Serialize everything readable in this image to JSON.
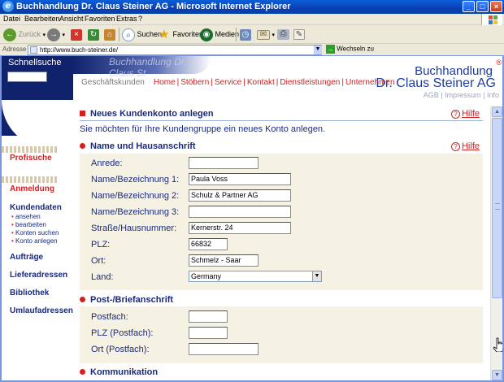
{
  "window": {
    "title": "Buchhandlung Dr. Claus Steiner AG - Microsoft Internet Explorer"
  },
  "menu": [
    "Datei",
    "Bearbeiten",
    "Ansicht",
    "Favoriten",
    "Extras",
    "?"
  ],
  "toolbar": {
    "back": "Zurück",
    "search": "Suchen",
    "favorites": "Favoriten",
    "media": "Medien"
  },
  "address": {
    "label": "Adresse",
    "url": "http://www.buch-steiner.de/",
    "go": "Wechseln zu"
  },
  "leftnav": {
    "quicksearch": "Schnellsuche",
    "profisuche": "Profisuche",
    "anmeldung": "Anmeldung",
    "kundendaten": "Kundendaten",
    "kundendaten_items": [
      "ansehen",
      "bearbeiten",
      "Konten suchen",
      "Konto anlegen"
    ],
    "auftraege": "Aufträge",
    "lieferadressen": "Lieferadressen",
    "bibliothek": "Bibliothek",
    "umlaufadressen": "Umlaufadressen"
  },
  "header": {
    "brand_line1": "Buchhandlung",
    "brand_line2": "Dr. Claus Steiner AG",
    "brand_reg": "®",
    "brand_ghost": "Buchhandlung Dr. Claus St",
    "segment": "Geschäftskunden",
    "nav": [
      "Home",
      "Stöbern",
      "Service",
      "Kontakt",
      "Dienstleistungen",
      "Unternehmen"
    ],
    "meta": "AGB | Impressum | Info"
  },
  "content": {
    "title": "Neues Kundenkonto anlegen",
    "help": "Hilfe",
    "intro": "Sie möchten für Ihre Kundengruppe ein neues Konto anlegen.",
    "section1": {
      "title": "Name und Hausanschrift",
      "help": "Hilfe",
      "fields": [
        {
          "label": "Anrede:",
          "value": ""
        },
        {
          "label": "Name/Bezeichnung 1:",
          "value": "Paula Voss"
        },
        {
          "label": "Name/Bezeichnung 2:",
          "value": "Schulz & Partner AG"
        },
        {
          "label": "Name/Bezeichnung 3:",
          "value": ""
        },
        {
          "label": "Straße/Hausnummer:",
          "value": "Kernerstr. 24"
        },
        {
          "label": "PLZ:",
          "value": "66832"
        },
        {
          "label": "Ort:",
          "value": "Schmelz - Saar"
        },
        {
          "label": "Land:",
          "value": "Germany"
        }
      ]
    },
    "section2": {
      "title": "Post-/Briefanschrift",
      "fields": [
        {
          "label": "Postfach:",
          "value": ""
        },
        {
          "label": "PLZ (Postfach):",
          "value": ""
        },
        {
          "label": "Ort (Postfach):",
          "value": ""
        }
      ]
    },
    "section3": {
      "title": "Kommunikation"
    }
  },
  "colors": {
    "brand_blue": "#1d3c9e",
    "nav_red": "#d32020",
    "form_bg": "#f6f2e3"
  }
}
